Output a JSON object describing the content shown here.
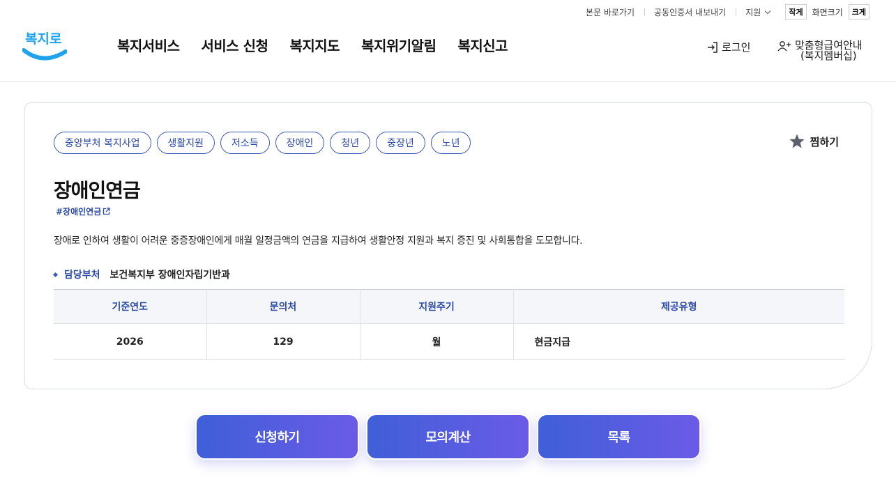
{
  "util": {
    "skip_content": "본문 바로가기",
    "export_cert": "공동인증서 내보내기",
    "support": "지원",
    "font_small": "작게",
    "font_size_label": "화면크기",
    "font_large": "크게"
  },
  "header": {
    "logo_text": "복지로",
    "nav": [
      "복지서비스",
      "서비스 신청",
      "복지지도",
      "복지위기알림",
      "복지신고"
    ],
    "login": "로그인",
    "member_line1": "맞춤형급여안내",
    "member_line2": "(복지멤버십)"
  },
  "service": {
    "tags": [
      "중앙부처 복지사업",
      "생활지원",
      "저소득",
      "장애인",
      "청년",
      "중장년",
      "노년"
    ],
    "bookmark": "찜하기",
    "title": "장애인연금",
    "hashtag": "#장애인연금",
    "description": "장애로 인하여 생활이 어려운 중증장애인에게 매월 일정금액의 연금을 지급하여 생활안정 지원과 복지 증진 및 사회통합을 도모합니다.",
    "dept_label": "담당부처",
    "dept_value": "보건복지부 장애인자립기반과",
    "table": {
      "headers": [
        "기준연도",
        "문의처",
        "지원주기",
        "제공유형"
      ],
      "rows": [
        [
          "2026",
          "129",
          "월",
          "현금지급"
        ]
      ]
    }
  },
  "actions": {
    "apply": "신청하기",
    "simulate": "모의계산",
    "list": "목록"
  },
  "colors": {
    "primary": "#2c4aa6",
    "button_gradient_start": "#3f5fd8",
    "button_gradient_end": "#6b5be6",
    "logo_blue": "#1fa3ec"
  }
}
